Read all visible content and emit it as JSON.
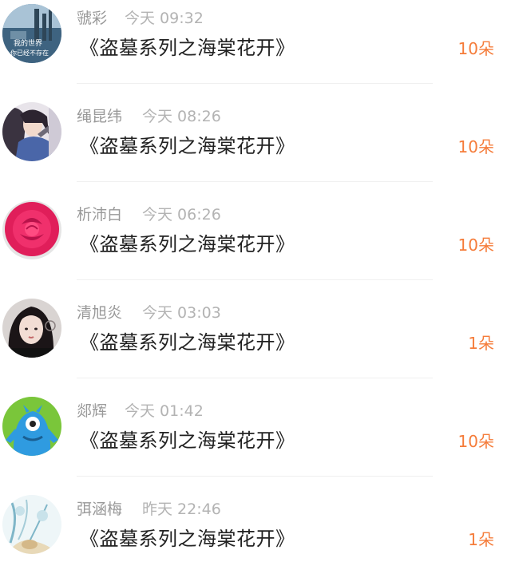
{
  "gifts": [
    {
      "name": "虢彩",
      "time": "今天 09:32",
      "title": "《盗墓系列之海棠花开》",
      "amount": "10朵",
      "avatar_text_1": "我的世界",
      "avatar_text_2": "你已经不存在"
    },
    {
      "name": "绳昆纬",
      "time": "今天 08:26",
      "title": "《盗墓系列之海棠花开》",
      "amount": "10朵"
    },
    {
      "name": "析沛白",
      "time": "今天 06:26",
      "title": "《盗墓系列之海棠花开》",
      "amount": "10朵"
    },
    {
      "name": "清旭炎",
      "time": "今天 03:03",
      "title": "《盗墓系列之海棠花开》",
      "amount": "1朵"
    },
    {
      "name": "郯辉",
      "time": "今天 01:42",
      "title": "《盗墓系列之海棠花开》",
      "amount": "10朵"
    },
    {
      "name": "弭涵梅",
      "time": "昨天 22:46",
      "title": "《盗墓系列之海棠花开》",
      "amount": "1朵"
    }
  ],
  "colors": {
    "accent": "#f57c3a",
    "name_text": "#999999",
    "time_text": "#b3b3b3",
    "title_text": "#222222",
    "divider": "#f0f0f0"
  }
}
